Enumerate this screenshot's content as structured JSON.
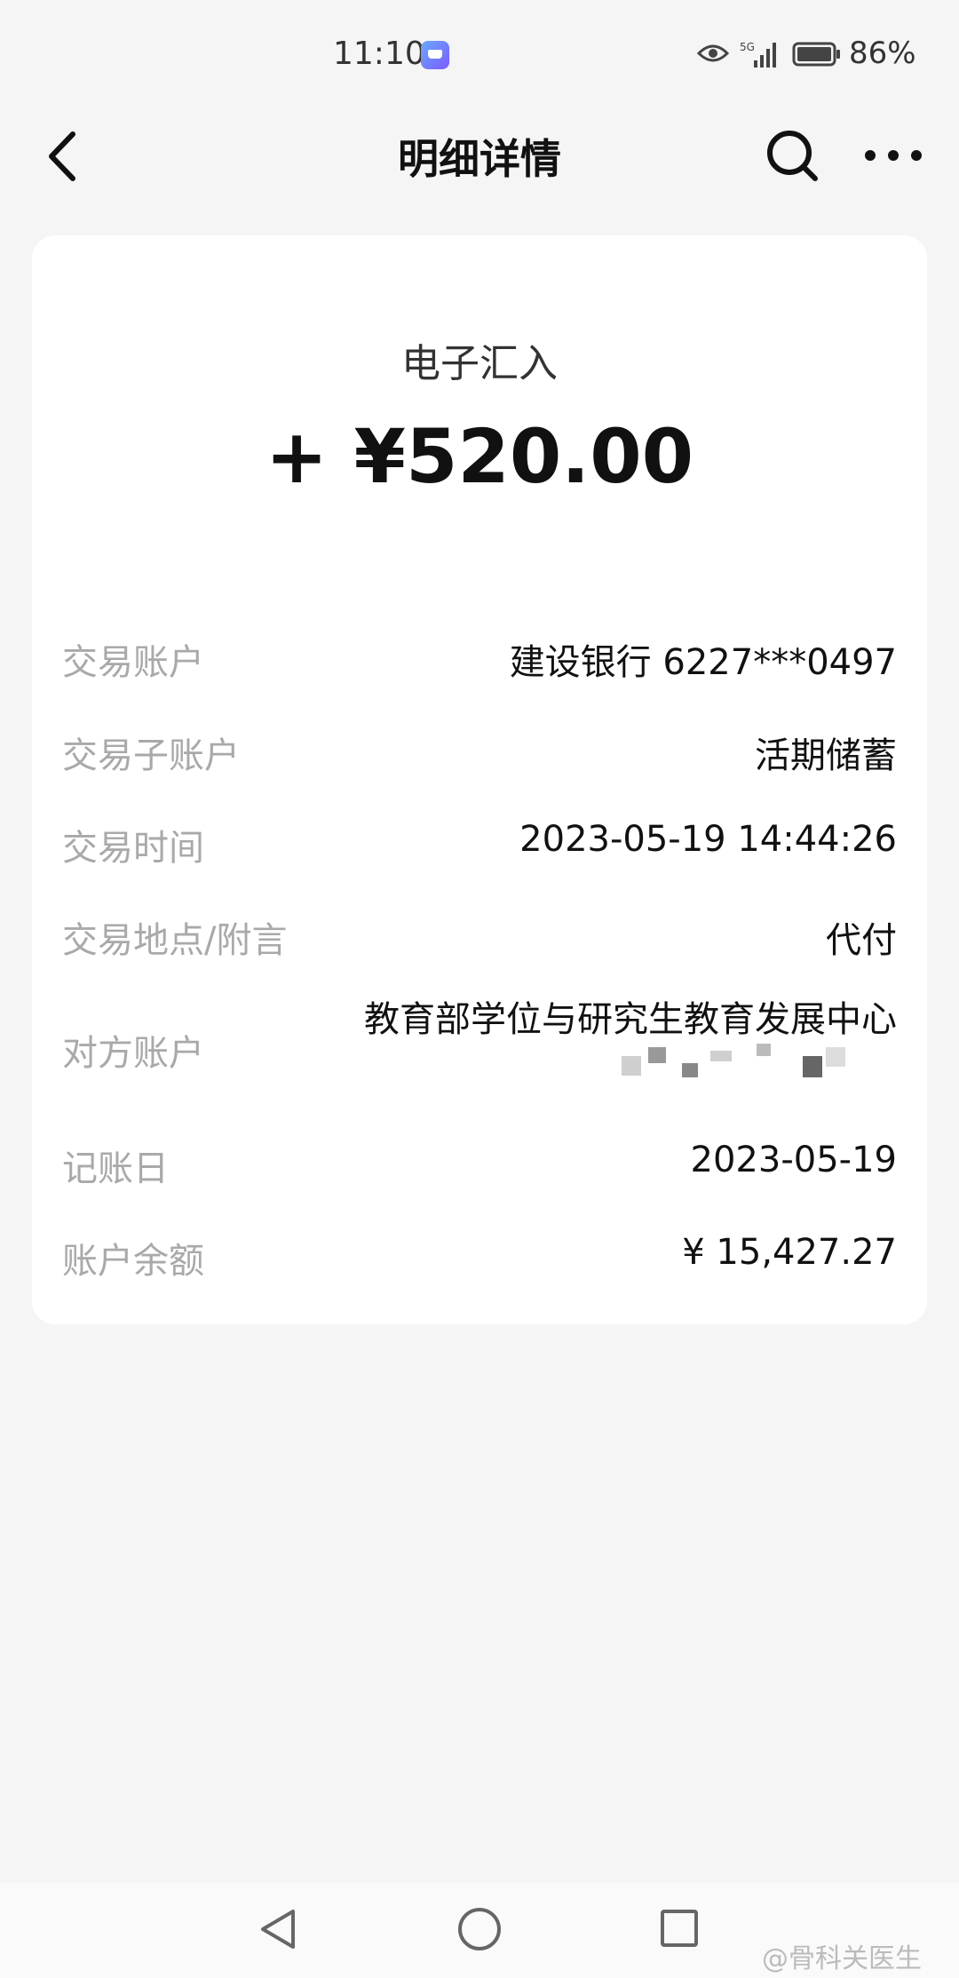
{
  "status_bar": {
    "time": "11:10",
    "battery_pct": "86%",
    "network": "5G"
  },
  "header": {
    "title": "明细详情"
  },
  "transaction": {
    "type": "电子汇入",
    "amount": "+ ¥520.00"
  },
  "details": [
    {
      "label": "交易账户",
      "value": "建设银行 6227***0497"
    },
    {
      "label": "交易子账户",
      "value": "活期储蓄"
    },
    {
      "label": "交易时间",
      "value": "2023-05-19 14:44:26"
    },
    {
      "label": "交易地点/附言",
      "value": "代付"
    },
    {
      "label": "对方账户",
      "value": "教育部学位与研究生教育发展中心"
    },
    {
      "label": "记账日",
      "value": "2023-05-19"
    },
    {
      "label": "账户余额",
      "value": "¥ 15,427.27"
    }
  ],
  "watermark": "@骨科关医生",
  "colors": {
    "background": "#f5f5f5",
    "card": "#ffffff",
    "label": "#a9a9a9",
    "text": "#111111"
  }
}
